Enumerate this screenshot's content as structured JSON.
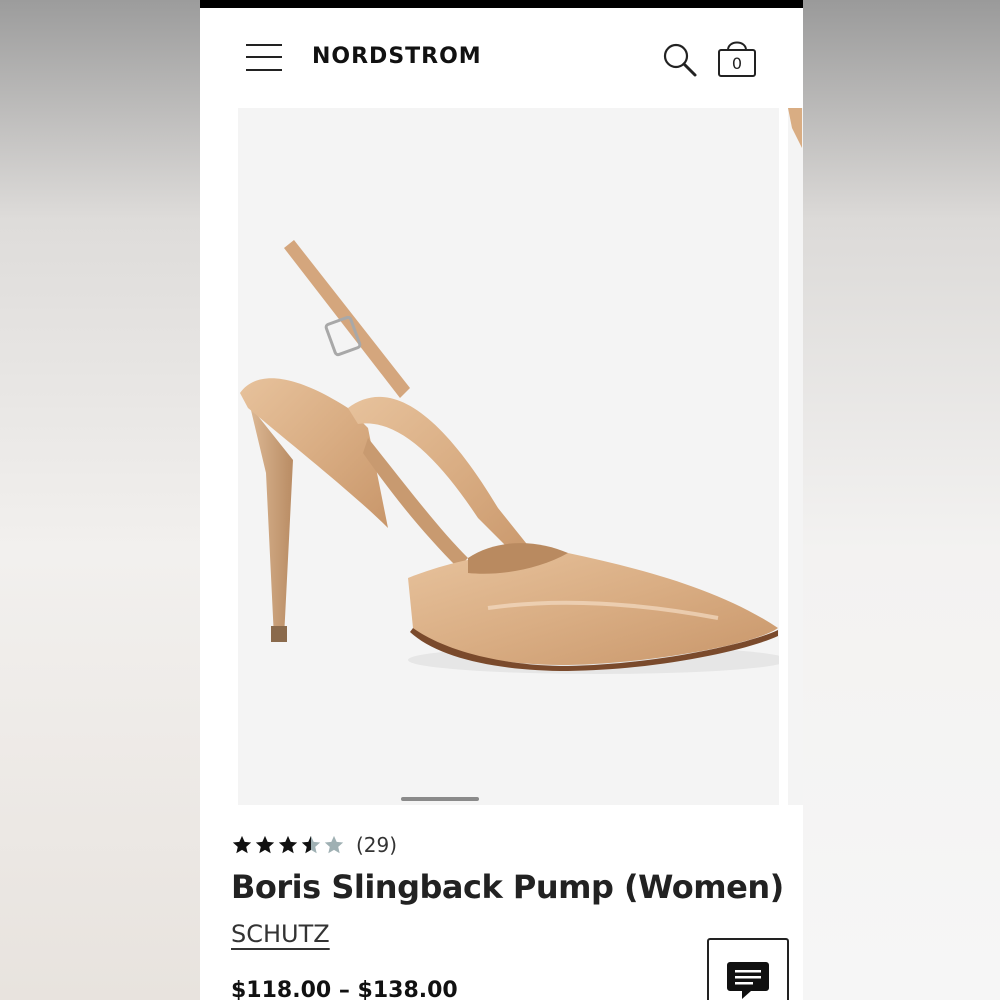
{
  "header": {
    "menu_icon": "hamburger-menu-icon",
    "logo_text": "NORDSTROM",
    "search_icon": "search-icon",
    "cart_icon": "shopping-bag-icon",
    "cart_count": "0"
  },
  "carousel": {
    "active_index": 0,
    "image_subject": "nude patent slingback pump"
  },
  "product": {
    "rating": 4.5,
    "rating_max": 5,
    "review_count": "(29)",
    "title": "Boris Slingback Pump (Women)",
    "brand": "SCHUTZ",
    "price": "$118.00 – $138.00"
  },
  "chat": {
    "icon": "chat-bubble-icon"
  },
  "colors": {
    "text": "#222222",
    "star_filled": "#111111",
    "star_empty": "#9fb0b3",
    "image_bg": "#f4f4f4",
    "shoe": "#d9ad83"
  }
}
